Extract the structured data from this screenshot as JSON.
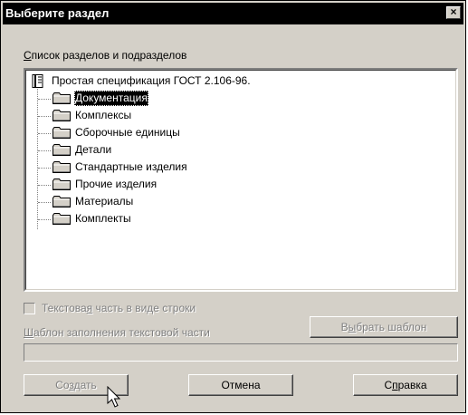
{
  "window": {
    "title": "Выберите раздел",
    "close_glyph": "×"
  },
  "tree_label": {
    "prefix": "С",
    "rest": "писок разделов и подразделов"
  },
  "tree": {
    "root": "Простая спецификация ГОСТ 2.106-96.",
    "root_icon": "book-icon",
    "selected_index": 0,
    "items": [
      {
        "label": "Документация",
        "icon": "folder-icon"
      },
      {
        "label": "Комплексы",
        "icon": "folder-icon"
      },
      {
        "label": "Сборочные единицы",
        "icon": "folder-icon"
      },
      {
        "label": "Детали",
        "icon": "folder-icon"
      },
      {
        "label": "Стандартные изделия",
        "icon": "folder-icon"
      },
      {
        "label": "Прочие изделия",
        "icon": "folder-icon"
      },
      {
        "label": "Материалы",
        "icon": "folder-icon"
      },
      {
        "label": "Комплекты",
        "icon": "folder-icon"
      }
    ]
  },
  "text_as_string": {
    "before": "Текстова",
    "underlined": "я",
    "after": " часть в виде строки",
    "checked": false,
    "enabled": false
  },
  "template": {
    "label_underlined": "Ш",
    "label_rest": "аблон заполнения текстовой части",
    "value": "",
    "select_button": {
      "before": "В",
      "underlined": "ы",
      "after": "брать шаблон"
    },
    "enabled": false
  },
  "buttons": {
    "create": {
      "before": "Со",
      "underlined": "з",
      "after": "дать",
      "enabled": false
    },
    "cancel": {
      "label": "Отмена"
    },
    "help": {
      "before": "С",
      "underlined": "п",
      "after": "равка"
    }
  },
  "colors": {
    "face": "#d4d0c8",
    "titlebar": "#000000",
    "disabled_text": "#808080"
  }
}
